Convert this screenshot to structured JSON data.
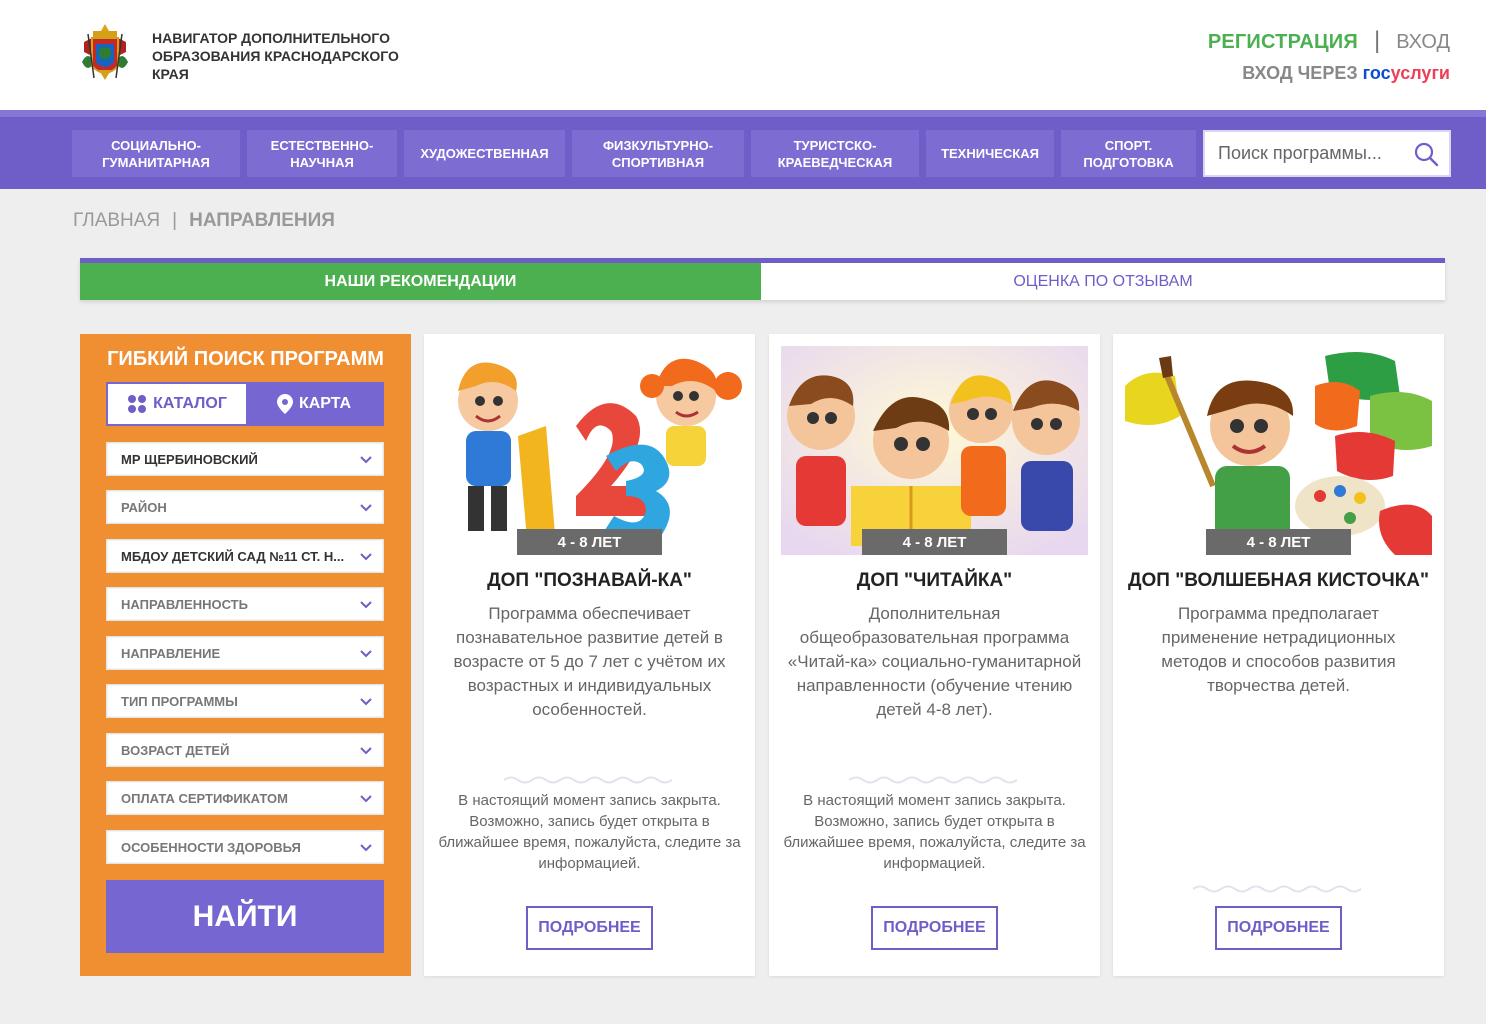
{
  "header": {
    "site_title": "НАВИГАТОР ДОПОЛНИТЕЛЬНОГО ОБРАЗОВАНИЯ КРАСНОДАРСКОГО КРАЯ",
    "register": "РЕГИСТРАЦИЯ",
    "separator": "|",
    "login": "ВХОД",
    "gos_prefix": "ВХОД ЧЕРЕЗ",
    "gos_part1": "гос",
    "gos_part2": "услуги"
  },
  "nav": {
    "items": [
      "СОЦИАЛЬНО-ГУМАНИТАРНАЯ",
      "ЕСТЕСТВЕННО-НАУЧНАЯ",
      "ХУДОЖЕСТВЕННАЯ",
      "ФИЗКУЛЬТУРНО-СПОРТИВНАЯ",
      "ТУРИСТСКО-КРАЕВЕДЧЕСКАЯ",
      "ТЕХНИЧЕСКАЯ",
      "СПОРТ. ПОДГОТОВКА"
    ],
    "search_placeholder": "Поиск программы..."
  },
  "breadcrumb": {
    "home": "ГЛАВНАЯ",
    "separator": "|",
    "current": "НАПРАВЛЕНИЯ"
  },
  "tabs": {
    "active": "НАШИ РЕКОМЕНДАЦИИ",
    "inactive": "ОЦЕНКА ПО ОТЗЫВАМ"
  },
  "filter": {
    "title": "ГИБКИЙ ПОИСК ПРОГРАММ",
    "catalog": "КАТАЛОГ",
    "map": "КАРТА",
    "selects": [
      "МР ЩЕРБИНОВСКИЙ",
      "РАЙОН",
      "МБДОУ ДЕТСКИЙ САД №11 СТ. Н...",
      "НАПРАВЛЕННОСТЬ",
      "НАПРАВЛЕНИЕ",
      "ТИП ПРОГРАММЫ",
      "ВОЗРАСТ ДЕТЕЙ",
      "ОПЛАТА СЕРТИФИКАТОМ",
      "ОСОБЕННОСТИ ЗДОРОВЬЯ"
    ],
    "find": "НАЙТИ"
  },
  "cards": [
    {
      "age": "4 - 8 ЛЕТ",
      "title": "ДОП \"ПОЗНАВАЙ-КА\"",
      "description": "Программа обеспечивает познавательное развитие детей в возрасте от 5 до 7 лет с учётом их возрастных и индивидуальных особенностей.",
      "status": "В настоящий момент запись закрыта. Возможно, запись будет открыта в ближайшее время, пожалуйста, следите за информацией.",
      "more": "ПОДРОБНЕЕ"
    },
    {
      "age": "4 - 8 ЛЕТ",
      "title": "ДОП \"ЧИТАЙКА\"",
      "description": "Дополнительная общеобразовательная программа «Читай-ка» социально-гуманитарной направленности (обучение чтению детей 4-8 лет).",
      "status": "В настоящий момент запись закрыта. Возможно, запись будет открыта в ближайшее время, пожалуйста, следите за информацией.",
      "more": "ПОДРОБНЕЕ"
    },
    {
      "age": "4 - 8 ЛЕТ",
      "title": "ДОП \"ВОЛШЕБНАЯ КИСТОЧКА\"",
      "description": "Программа предполагает применение нетрадиционных методов и способов развития творчества детей.",
      "status": "",
      "more": "ПОДРОБНЕЕ"
    }
  ],
  "colors": {
    "purple": "#6f5ec8",
    "green": "#4caf50",
    "orange": "#f08e32"
  }
}
